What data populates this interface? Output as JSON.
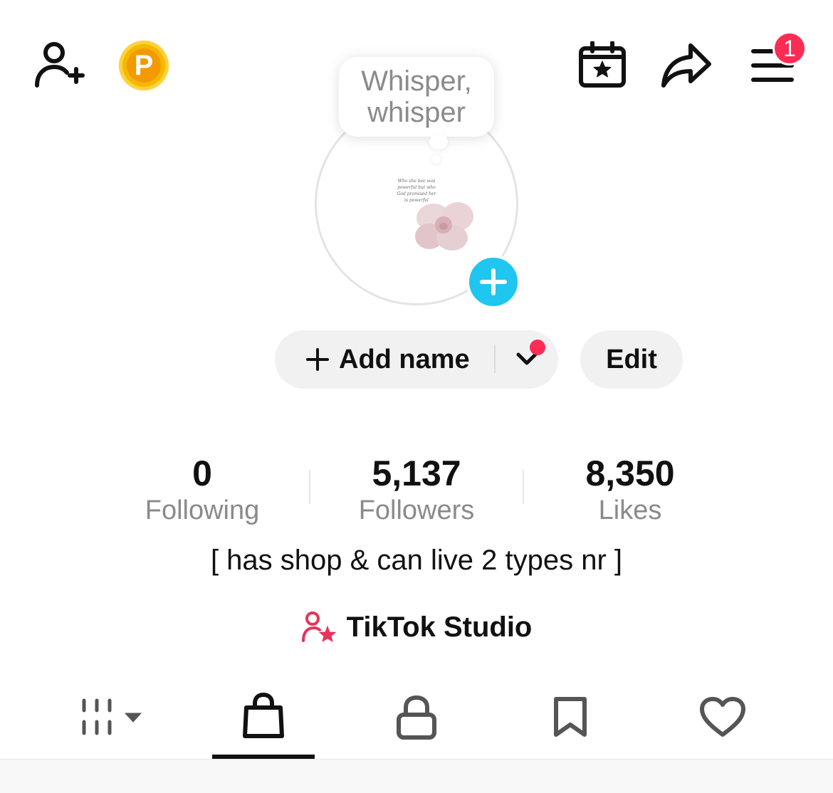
{
  "header": {
    "notification_count": "1",
    "coin_letter": "P"
  },
  "profile": {
    "thought_bubble": [
      "Whisper,",
      "whisper"
    ],
    "avatar_caption_lines": [
      "Who she bee was",
      "powerful but who",
      "God promised her",
      "is powerful"
    ],
    "add_name_label": "Add name",
    "edit_label": "Edit"
  },
  "stats": [
    {
      "value": "0",
      "label": "Following"
    },
    {
      "value": "5,137",
      "label": "Followers"
    },
    {
      "value": "8,350",
      "label": "Likes"
    }
  ],
  "bio": "[ has shop & can live 2 types nr ]",
  "studio_label": "TikTok Studio",
  "tabs": [
    {
      "icon": "grid-icon",
      "selected": false
    },
    {
      "icon": "shopping-bag-icon",
      "selected": true
    },
    {
      "icon": "lock-icon",
      "selected": false
    },
    {
      "icon": "bookmark-icon",
      "selected": false
    },
    {
      "icon": "heart-icon",
      "selected": false
    }
  ],
  "colors": {
    "accent_red": "#fe2c55",
    "accent_cyan": "#1fc6ef",
    "coin": "#f5b800",
    "muted_text": "#8a8a8a"
  }
}
